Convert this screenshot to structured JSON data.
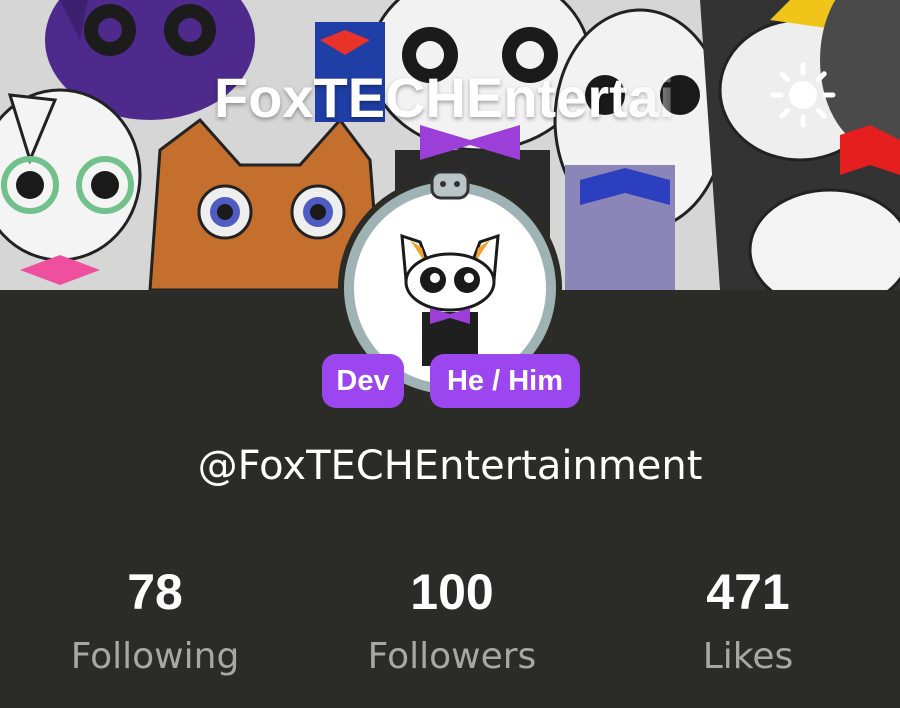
{
  "profile": {
    "title": "FoxTECHEntertai",
    "handle": "@FoxTECHEntertainment",
    "badges": {
      "role": "Dev",
      "pronouns": "He / Him"
    }
  },
  "header": {
    "theme_icon": "sun-icon"
  },
  "stats": {
    "following": {
      "value": "78",
      "label": "Following"
    },
    "followers": {
      "value": "100",
      "label": "Followers"
    },
    "likes": {
      "value": "471",
      "label": "Likes"
    }
  },
  "colors": {
    "panel_bg": "#2b2c27",
    "badge_bg": "#9b46ee",
    "stat_label": "#a7a7a7"
  }
}
